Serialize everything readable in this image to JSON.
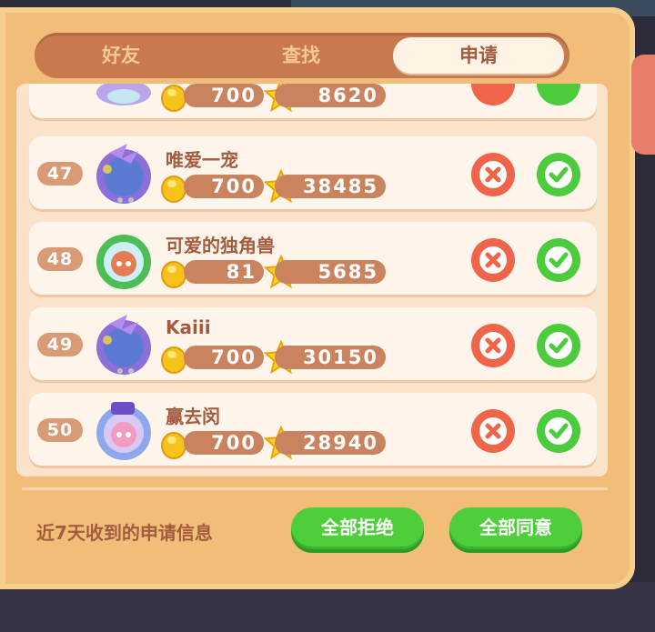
{
  "tabs": [
    {
      "label": "好友",
      "active": false
    },
    {
      "label": "查找",
      "active": false
    },
    {
      "label": "申请",
      "active": true
    }
  ],
  "requests": [
    {
      "rank": "",
      "name": "",
      "coins": "700",
      "stars": "8620"
    },
    {
      "rank": "47",
      "name": "唯爱一宠",
      "coins": "700",
      "stars": "38485"
    },
    {
      "rank": "48",
      "name": "可爱的独角兽",
      "coins": "81",
      "stars": "5685"
    },
    {
      "rank": "49",
      "name": "Kaiii",
      "coins": "700",
      "stars": "30150"
    },
    {
      "rank": "50",
      "name": "赢去闵",
      "coins": "700",
      "stars": "28940"
    }
  ],
  "footer": {
    "info": "近7天收到的申请信息",
    "reject_all": "全部拒绝",
    "accept_all": "全部同意"
  },
  "icons": {
    "coin": "coin-icon",
    "star": "star-icon",
    "reject": "close-icon",
    "accept": "check-icon"
  },
  "colors": {
    "panel": "#f2bd78",
    "tab_bar": "#c9794e",
    "reject": "#f0644a",
    "accept": "#4ccb3c",
    "text": "#a35b3f"
  }
}
